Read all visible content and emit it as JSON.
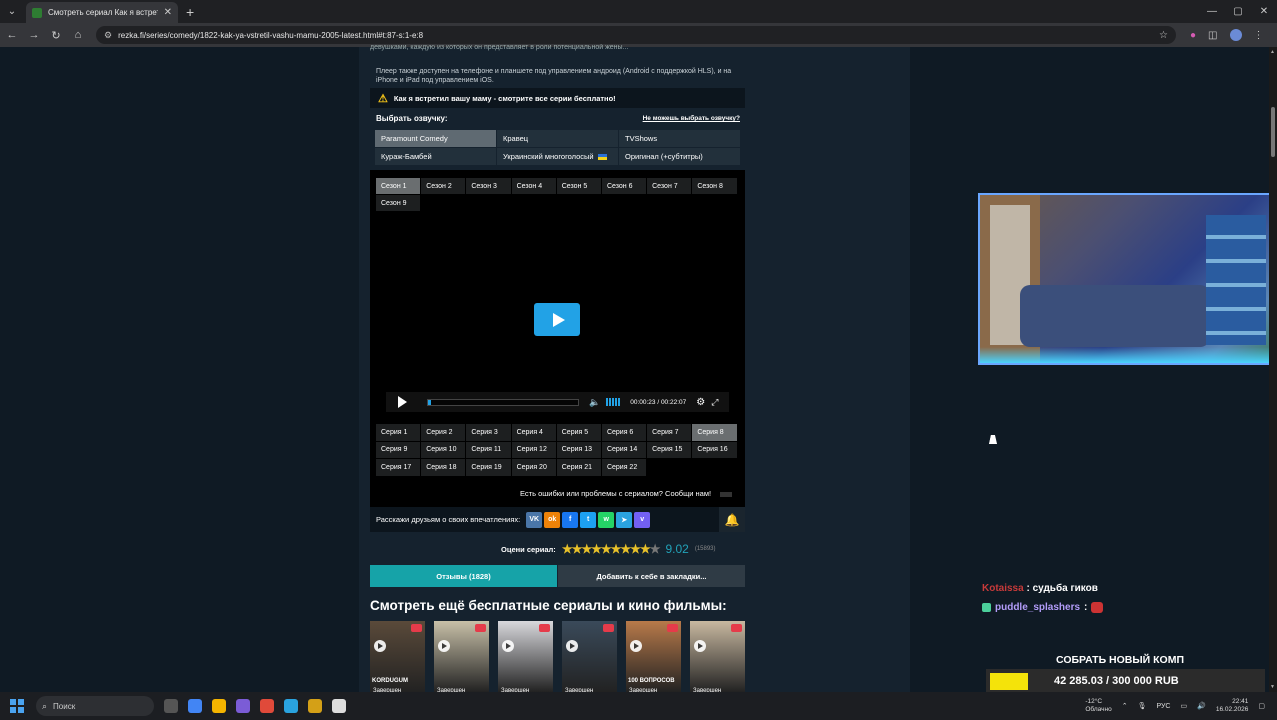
{
  "browser": {
    "tab_title": "Смотреть сериал Как я встрет...",
    "url": "rezka.fi/series/comedy/1822-kak-ya-vstretil-vashu-mamu-2005-latest.html#t:87-s:1-e:8"
  },
  "page": {
    "cut_text": "девушками, каждую из которых он представляет в роли потенциальной жены...",
    "info_text": "Плеер также доступен на телефоне и планшете под управлением андроид (Android с поддержкой HLS), и на iPhone и iPad под управлением iOS.",
    "warning": "Как я встретил вашу маму - смотрите все серии бесплатно!",
    "voice_title": "Выбрать озвучку:",
    "cant_choose": "Не можешь выбрать озвучку?",
    "voices": [
      {
        "label": "Paramount Comedy",
        "active": true
      },
      {
        "label": "Кравец",
        "active": false
      },
      {
        "label": "TVShows",
        "active": false
      },
      {
        "label": "Кураж-Бамбей",
        "active": false
      },
      {
        "label": "Украинский многоголосый",
        "active": false
      },
      {
        "label": "Оригинал (+субтитры)",
        "active": false
      }
    ],
    "seasons": [
      "Сезон 1",
      "Сезон 2",
      "Сезон 3",
      "Сезон 4",
      "Сезон 5",
      "Сезон 6",
      "Сезон 7",
      "Сезон 8",
      "Сезон 9"
    ],
    "episodes": [
      "Серия 1",
      "Серия 2",
      "Серия 3",
      "Серия 4",
      "Серия 5",
      "Серия 6",
      "Серия 7",
      "Серия 8",
      "Серия 9",
      "Серия 10",
      "Серия 11",
      "Серия 12",
      "Серия 13",
      "Серия 14",
      "Серия 15",
      "Серия 16",
      "Серия 17",
      "Серия 18",
      "Серия 19",
      "Серия 20",
      "Серия 21",
      "Серия 22"
    ],
    "active_episode": 7,
    "player": {
      "time": "00:00:23 / 00:22:07",
      "progress": 0.017
    },
    "report": "Есть ошибки или проблемы с сериалом? Сообщи нам!",
    "share_label": "Расскажи друзьям о своих впечатлениях:",
    "social": [
      {
        "name": "vk",
        "glyph": "VK",
        "color": "#4a76a8"
      },
      {
        "name": "ok",
        "glyph": "ok",
        "color": "#ee8208"
      },
      {
        "name": "facebook",
        "glyph": "f",
        "color": "#1877f2"
      },
      {
        "name": "twitter",
        "glyph": "t",
        "color": "#1da1f2"
      },
      {
        "name": "whatsapp",
        "glyph": "w",
        "color": "#25d366"
      },
      {
        "name": "telegram",
        "glyph": "➤",
        "color": "#2aa3df"
      },
      {
        "name": "viber",
        "glyph": "v",
        "color": "#7360f2"
      }
    ],
    "rating_label": "Оцени сериал:",
    "rating_value": "9.02",
    "rating_count": "(15893)",
    "rating_stars_filled": 9,
    "reviews_btn": "Отзывы (1828)",
    "bookmark_btn": "Добавить к себе в закладки...",
    "more_title": "Смотреть ещё бесплатные сериалы и кино фильмы:",
    "posters": [
      {
        "caption": "KORDUGUM",
        "bg": "#5a4a3a"
      },
      {
        "caption": "",
        "bg": "#c8c0a8"
      },
      {
        "caption": "",
        "bg": "#d8d8dc"
      },
      {
        "caption": "",
        "bg": "#3a4a5a"
      },
      {
        "caption": "100 ВОПРОСОВ",
        "bg": "#b87a4a"
      },
      {
        "caption": "",
        "bg": "#c8b8a0"
      }
    ],
    "poster_label": "Завершен"
  },
  "overlay": {
    "chat": [
      {
        "user": "Kotaissa",
        "text": ": судьба гиков"
      },
      {
        "user": "puddle_splashers",
        "text": ":"
      }
    ],
    "goal_title": "СОБРАТЬ НОВЫЙ КОМП",
    "goal_text": "42 285.03 / 300 000 RUB",
    "goal_progress": 0.141
  },
  "taskbar": {
    "search": "Поиск",
    "weather_temp": "-12°C",
    "weather_desc": "Облачно",
    "lang": "РУС",
    "time": "22:41",
    "date": "16.02.2026"
  }
}
